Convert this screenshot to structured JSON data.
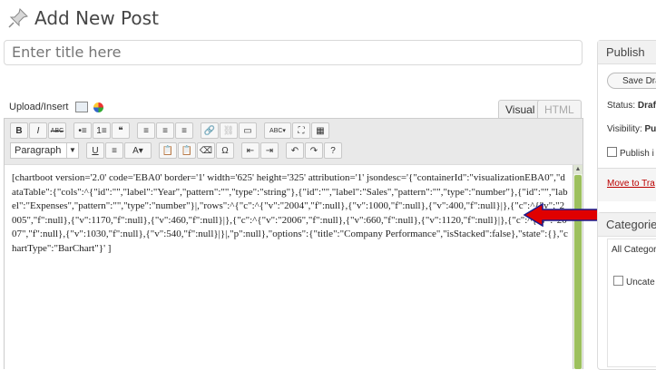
{
  "page": {
    "title": "Add New Post"
  },
  "title_input": {
    "placeholder": "Enter title here"
  },
  "media": {
    "upload_label": "Upload/Insert"
  },
  "editor_tabs": {
    "visual": "Visual",
    "html": "HTML"
  },
  "toolbar": {
    "row1": [
      "B",
      "I",
      "ABC",
      "•≡",
      "1≡",
      "❝",
      "≡",
      "≡",
      "≡",
      "🔗",
      "⛓",
      "▭",
      "ABC▾",
      "⛶",
      "▦"
    ],
    "format_select": "Paragraph",
    "row2_buttons": [
      "U",
      "≡",
      "A▾",
      "📋",
      "📋",
      "⌫",
      "Ω",
      "⇤",
      "⇥",
      "↶",
      "↷",
      "?"
    ]
  },
  "content": "[chartboot version='2.0' code='EBA0' border='1' width='625' height='325' attribution='1' jsondesc='{\"containerId\":\"visualizationEBA0\",\"dataTable\":{\"cols\":^{\"id\":\"\",\"label\":\"Year\",\"pattern\":\"\",\"type\":\"string\"},{\"id\":\"\",\"label\":\"Sales\",\"pattern\":\"\",\"type\":\"number\"},{\"id\":\"\",\"label\":\"Expenses\",\"pattern\":\"\",\"type\":\"number\"}|,\"rows\":^{\"c\":^{\"v\":\"2004\",\"f\":null},{\"v\":1000,\"f\":null},{\"v\":400,\"f\":null}|},{\"c\":^{\"v\":\"2005\",\"f\":null},{\"v\":1170,\"f\":null},{\"v\":460,\"f\":null}|},{\"c\":^{\"v\":\"2006\",\"f\":null},{\"v\":660,\"f\":null},{\"v\":1120,\"f\":null}|},{\"c\":^{\"v\":\"2007\",\"f\":null},{\"v\":1030,\"f\":null},{\"v\":540,\"f\":null}|}|,\"p\":null},\"options\":{\"title\":\"Company Performance\",\"isStacked\":false},\"state\":{},\"chartType\":\"BarChart\"}' ]",
  "publish_box": {
    "heading": "Publish",
    "save_draft": "Save Dra",
    "status_label": "Status:",
    "status_value": "Draf",
    "visibility_label": "Visibility:",
    "visibility_value": "Pul",
    "publish_label": "Publish i",
    "move_to_trash": "Move to Tra"
  },
  "categories_box": {
    "heading": "Categories",
    "all_tab": "All Categor",
    "item": "Uncate"
  },
  "colors": {
    "arrow": "#e00000",
    "arrow_outline": "#1a1a8c",
    "scroll_thumb": "#9cc05d"
  }
}
